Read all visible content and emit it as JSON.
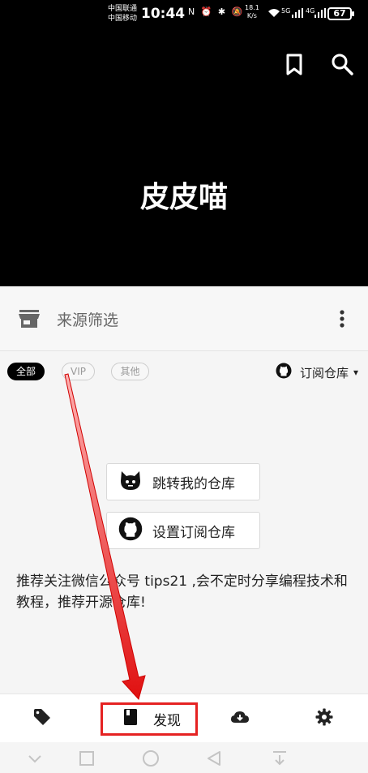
{
  "status_bar": {
    "carrier_1": "中国联通",
    "carrier_2": "中国移动",
    "time": "10:44",
    "icons": "N ⏰ ✱ 🔕",
    "net_speed_value": "18.1",
    "net_speed_unit": "K/s",
    "signal_1": "5G",
    "signal_2": "4G",
    "battery": "67"
  },
  "hero": {
    "title": "皮皮喵",
    "bookmark_icon": "bookmark-icon",
    "search_icon": "search-icon",
    "background": "#000000"
  },
  "filter": {
    "label": "来源筛选",
    "store_icon": "store-icon",
    "more_icon": "more-vertical-icon"
  },
  "chips": [
    "全部",
    "VIP",
    "其他"
  ],
  "active_chip": "全部",
  "repo_select": {
    "label": "订阅仓库",
    "icon": "github-icon",
    "caret": "▾"
  },
  "actions": {
    "jump_label": "跳转我的仓库",
    "set_label": "设置订阅仓库"
  },
  "notice": "推荐关注微信公众号 tips21 ,会不定时分享编程技术和教程，推荐开源仓库!",
  "tabbar": {
    "discover_label": "发现",
    "highlight_color": "#e52222"
  },
  "navbar": {
    "icons": [
      "collapse-icon",
      "recent-apps-icon",
      "home-icon",
      "back-icon",
      "download-tray-icon"
    ]
  }
}
